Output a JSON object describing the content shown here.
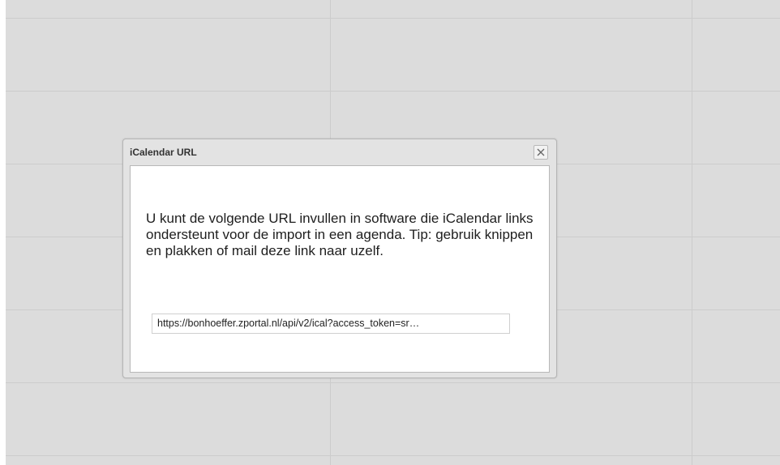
{
  "dialog": {
    "title": "iCalendar URL",
    "close_icon": "close-x-icon",
    "message": "U kunt de volgende URL invullen in software die iCalendar links ondersteunt voor de import in een agenda. Tip: gebruik knippen en plakken of mail deze link naar uzelf.",
    "url_value": "https://bonhoeffer.zportal.nl/api/v2/ical?access_token=sr…"
  }
}
